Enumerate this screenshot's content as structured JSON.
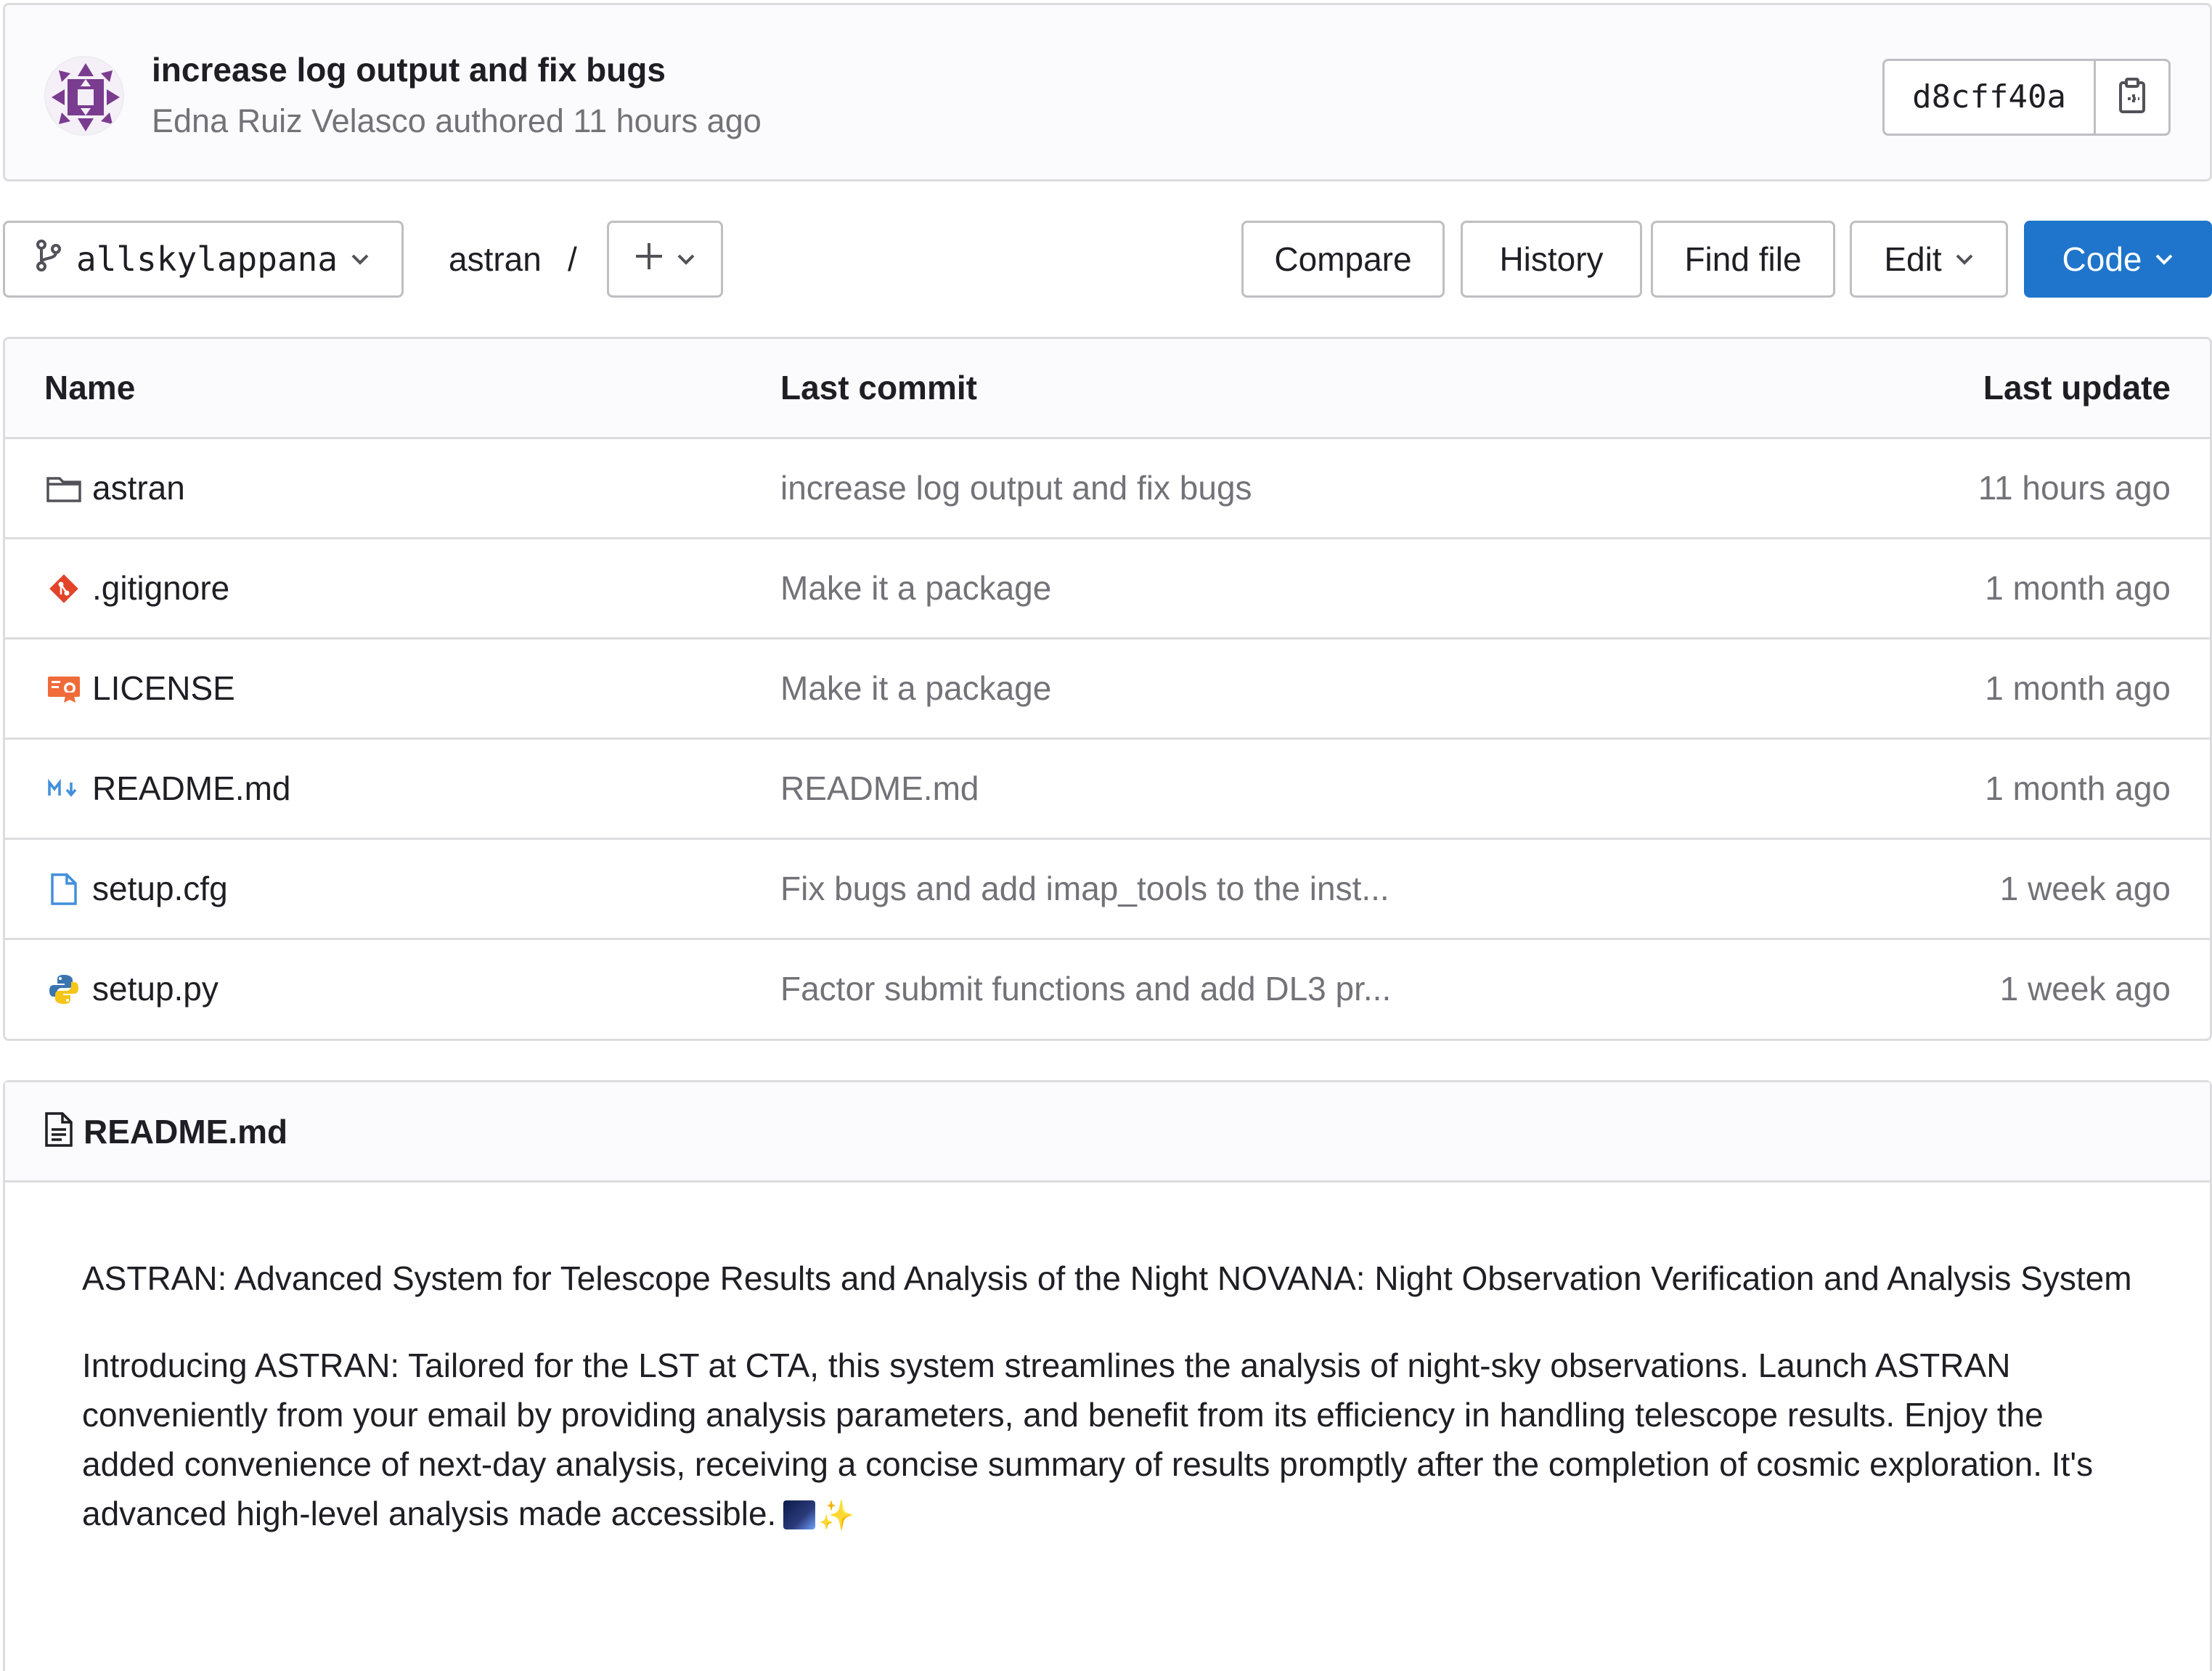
{
  "commit": {
    "title": "increase log output and fix bugs",
    "meta": "Edna Ruiz Velasco authored 11 hours ago",
    "sha": "d8cff40a"
  },
  "toolbar": {
    "branch": "allskylappana",
    "breadcrumb": "astran",
    "separator": "/",
    "compare": "Compare",
    "history": "History",
    "find_file": "Find file",
    "edit": "Edit",
    "code": "Code"
  },
  "table": {
    "headers": {
      "name": "Name",
      "last_commit": "Last commit",
      "last_update": "Last update"
    },
    "rows": [
      {
        "name": "astran",
        "icon": "folder-icon",
        "commit": "increase log output and fix bugs",
        "updated": "11 hours ago"
      },
      {
        "name": ".gitignore",
        "icon": "git-icon",
        "commit": "Make it a package",
        "updated": "1 month ago"
      },
      {
        "name": "LICENSE",
        "icon": "certificate-icon",
        "commit": "Make it a package",
        "updated": "1 month ago"
      },
      {
        "name": "README.md",
        "icon": "markdown-icon",
        "commit": "README.md",
        "updated": "1 month ago"
      },
      {
        "name": "setup.cfg",
        "icon": "file-icon",
        "commit": "Fix bugs and add imap_tools to the inst...",
        "updated": "1 week ago"
      },
      {
        "name": "setup.py",
        "icon": "python-icon",
        "commit": "Factor submit functions and add DL3 pr...",
        "updated": "1 week ago"
      }
    ]
  },
  "readme": {
    "title": "README.md",
    "paragraph1": "ASTRAN: Advanced System for Telescope Results and Analysis of the Night NOVANA: Night Observation Verification and Analysis System",
    "paragraph2": "Introducing ASTRAN: Tailored for the LST at CTA, this system streamlines the analysis of night-sky observations. Launch ASTRAN conveniently from your email by providing analysis parameters, and benefit from its efficiency in handling telescope results. Enjoy the added convenience of next-day analysis, receiving a concise summary of results promptly after the completion of cosmic exploration. It's advanced high-level analysis made accessible.",
    "emoji_icons": [
      "milky-way-icon",
      "sparkles-icon"
    ]
  },
  "colors": {
    "accent": "#1f75cb",
    "muted_text": "#737278",
    "border": "#dcdcde",
    "header_bg": "#fbfafd"
  }
}
